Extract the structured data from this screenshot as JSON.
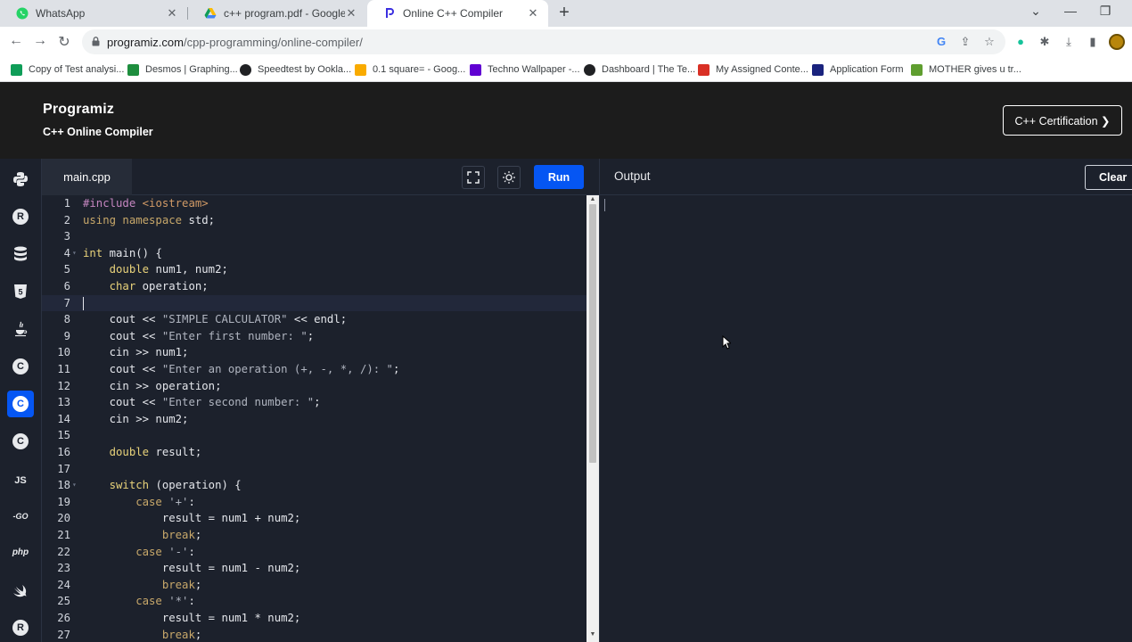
{
  "browser": {
    "tabs": [
      {
        "title": "WhatsApp",
        "icon": "whatsapp-icon"
      },
      {
        "title": "c++ program.pdf - Google Drive",
        "icon": "google-drive-icon"
      },
      {
        "title": "Online C++ Compiler",
        "icon": "programiz-icon"
      }
    ],
    "new_tab": "+",
    "close_glyph": "✕",
    "url_host": "programiz.com",
    "url_path": "/cpp-programming/online-compiler/",
    "bookmarks": [
      {
        "label": "Copy of Test analysi...",
        "color": "#0f9d58"
      },
      {
        "label": "Desmos | Graphing...",
        "color": "#1e8e3e"
      },
      {
        "label": "Speedtest by Ookla...",
        "color": "#202124"
      },
      {
        "label": "0.1 square= - Goog...",
        "color": "#f9ab00"
      },
      {
        "label": "Techno Wallpaper -...",
        "color": "#6001d2"
      },
      {
        "label": "Dashboard | The Te...",
        "color": "#202124"
      },
      {
        "label": "My Assigned Conte...",
        "color": "#d93025"
      },
      {
        "label": "Application Form",
        "color": "#1a237e"
      },
      {
        "label": "MOTHER gives u tr...",
        "color": "#5f9e2f"
      }
    ]
  },
  "header": {
    "logo": "Programiz",
    "subtitle": "C++ Online Compiler",
    "cert_button": "C++ Certification ❯"
  },
  "languages": [
    {
      "name": "python",
      "glyph": "",
      "selected": false
    },
    {
      "name": "r",
      "glyph": "R",
      "selected": false
    },
    {
      "name": "sql",
      "glyph": "",
      "selected": false
    },
    {
      "name": "html",
      "glyph": "5",
      "selected": false
    },
    {
      "name": "java",
      "glyph": "",
      "selected": false
    },
    {
      "name": "c",
      "glyph": "C",
      "selected": false
    },
    {
      "name": "cpp",
      "glyph": "C",
      "selected": true
    },
    {
      "name": "csharp",
      "glyph": "C",
      "selected": false
    },
    {
      "name": "javascript",
      "glyph": "JS",
      "selected": false
    },
    {
      "name": "go",
      "glyph": "-GO",
      "selected": false
    },
    {
      "name": "php",
      "glyph": "php",
      "selected": false
    },
    {
      "name": "swift",
      "glyph": "",
      "selected": false
    },
    {
      "name": "rust",
      "glyph": "R",
      "selected": false
    }
  ],
  "editor": {
    "file_name": "main.cpp",
    "run_label": "Run",
    "cursor_line": 7,
    "lines": [
      {
        "n": "1",
        "fold": false,
        "tokens": [
          {
            "t": "#include ",
            "c": "#c586c0"
          },
          {
            "t": "<iostream>",
            "c": "#d19a66"
          }
        ]
      },
      {
        "n": "2",
        "fold": false,
        "tokens": [
          {
            "t": "using namespace ",
            "c": "#c8a86a"
          },
          {
            "t": "std;",
            "c": "#e4e6eb"
          }
        ]
      },
      {
        "n": "3",
        "fold": false,
        "tokens": []
      },
      {
        "n": "4",
        "fold": true,
        "tokens": [
          {
            "t": "int ",
            "c": "#e8d27a"
          },
          {
            "t": "main() {",
            "c": "#e4e6eb"
          }
        ]
      },
      {
        "n": "5",
        "fold": false,
        "tokens": [
          {
            "t": "    double ",
            "c": "#e8d27a"
          },
          {
            "t": "num1, num2;",
            "c": "#e4e6eb"
          }
        ]
      },
      {
        "n": "6",
        "fold": false,
        "tokens": [
          {
            "t": "    char ",
            "c": "#e8d27a"
          },
          {
            "t": "operation;",
            "c": "#e4e6eb"
          }
        ]
      },
      {
        "n": "7",
        "fold": false,
        "tokens": []
      },
      {
        "n": "8",
        "fold": false,
        "tokens": [
          {
            "t": "    cout << ",
            "c": "#e4e6eb"
          },
          {
            "t": "\"SIMPLE CALCULATOR\"",
            "c": "#b0b5c0"
          },
          {
            "t": " << endl;",
            "c": "#e4e6eb"
          }
        ]
      },
      {
        "n": "9",
        "fold": false,
        "tokens": [
          {
            "t": "    cout << ",
            "c": "#e4e6eb"
          },
          {
            "t": "\"Enter first number: \"",
            "c": "#b0b5c0"
          },
          {
            "t": ";",
            "c": "#e4e6eb"
          }
        ]
      },
      {
        "n": "10",
        "fold": false,
        "tokens": [
          {
            "t": "    cin >> num1;",
            "c": "#e4e6eb"
          }
        ]
      },
      {
        "n": "11",
        "fold": false,
        "tokens": [
          {
            "t": "    cout << ",
            "c": "#e4e6eb"
          },
          {
            "t": "\"Enter an operation (+, -, *, /): \"",
            "c": "#b0b5c0"
          },
          {
            "t": ";",
            "c": "#e4e6eb"
          }
        ]
      },
      {
        "n": "12",
        "fold": false,
        "tokens": [
          {
            "t": "    cin >> operation;",
            "c": "#e4e6eb"
          }
        ]
      },
      {
        "n": "13",
        "fold": false,
        "tokens": [
          {
            "t": "    cout << ",
            "c": "#e4e6eb"
          },
          {
            "t": "\"Enter second number: \"",
            "c": "#b0b5c0"
          },
          {
            "t": ";",
            "c": "#e4e6eb"
          }
        ]
      },
      {
        "n": "14",
        "fold": false,
        "tokens": [
          {
            "t": "    cin >> num2;",
            "c": "#e4e6eb"
          }
        ]
      },
      {
        "n": "15",
        "fold": false,
        "tokens": []
      },
      {
        "n": "16",
        "fold": false,
        "tokens": [
          {
            "t": "    double ",
            "c": "#e8d27a"
          },
          {
            "t": "result;",
            "c": "#e4e6eb"
          }
        ]
      },
      {
        "n": "17",
        "fold": false,
        "tokens": []
      },
      {
        "n": "18",
        "fold": true,
        "tokens": [
          {
            "t": "    switch ",
            "c": "#e8d27a"
          },
          {
            "t": "(operation) {",
            "c": "#e4e6eb"
          }
        ]
      },
      {
        "n": "19",
        "fold": false,
        "tokens": [
          {
            "t": "        case ",
            "c": "#c8a86a"
          },
          {
            "t": "'+'",
            "c": "#b0b5c0"
          },
          {
            "t": ":",
            "c": "#e4e6eb"
          }
        ]
      },
      {
        "n": "20",
        "fold": false,
        "tokens": [
          {
            "t": "            result = num1 + num2;",
            "c": "#e4e6eb"
          }
        ]
      },
      {
        "n": "21",
        "fold": false,
        "tokens": [
          {
            "t": "            break",
            "c": "#c8a86a"
          },
          {
            "t": ";",
            "c": "#e4e6eb"
          }
        ]
      },
      {
        "n": "22",
        "fold": false,
        "tokens": [
          {
            "t": "        case ",
            "c": "#c8a86a"
          },
          {
            "t": "'-'",
            "c": "#b0b5c0"
          },
          {
            "t": ":",
            "c": "#e4e6eb"
          }
        ]
      },
      {
        "n": "23",
        "fold": false,
        "tokens": [
          {
            "t": "            result = num1 - num2;",
            "c": "#e4e6eb"
          }
        ]
      },
      {
        "n": "24",
        "fold": false,
        "tokens": [
          {
            "t": "            break",
            "c": "#c8a86a"
          },
          {
            "t": ";",
            "c": "#e4e6eb"
          }
        ]
      },
      {
        "n": "25",
        "fold": false,
        "tokens": [
          {
            "t": "        case ",
            "c": "#c8a86a"
          },
          {
            "t": "'*'",
            "c": "#b0b5c0"
          },
          {
            "t": ":",
            "c": "#e4e6eb"
          }
        ]
      },
      {
        "n": "26",
        "fold": false,
        "tokens": [
          {
            "t": "            result = num1 * num2;",
            "c": "#e4e6eb"
          }
        ]
      },
      {
        "n": "27",
        "fold": false,
        "tokens": [
          {
            "t": "            break",
            "c": "#c8a86a"
          },
          {
            "t": ";",
            "c": "#e4e6eb"
          }
        ]
      }
    ]
  },
  "output": {
    "title": "Output",
    "clear_label": "Clear",
    "content": ""
  },
  "colors": {
    "accent": "#0556f3",
    "editor_bg": "#1c212c",
    "header_bg": "#1c1c1c"
  }
}
